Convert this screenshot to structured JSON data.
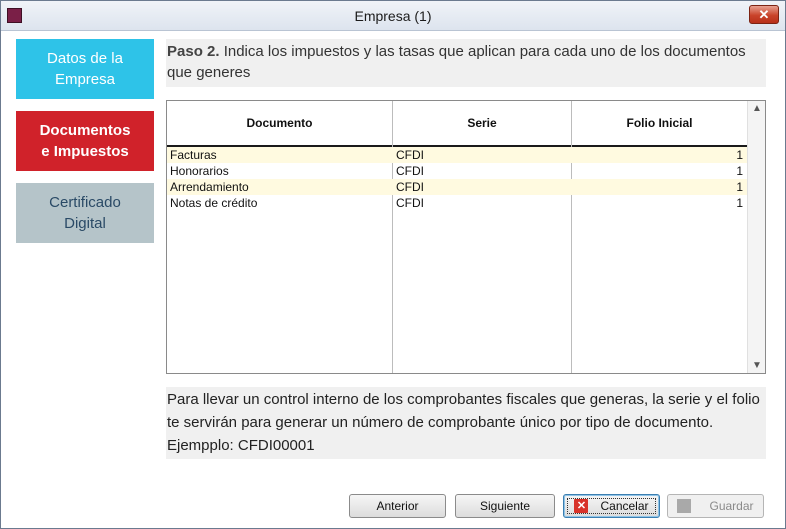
{
  "window": {
    "title": "Empresa (1)",
    "close_symbol": "✕"
  },
  "nav": {
    "items": [
      {
        "line1": "Datos de la",
        "line2": "Empresa"
      },
      {
        "line1": "Documentos",
        "line2": "e Impuestos"
      },
      {
        "line1": "Certificado",
        "line2": "Digital"
      }
    ]
  },
  "step": {
    "label": "Paso 2.",
    "text": "Indica los impuestos y las tasas que aplican para cada uno de los documentos que generes"
  },
  "table": {
    "headers": [
      "Documento",
      "Serie",
      "Folio Inicial"
    ],
    "rows": [
      {
        "documento": "Facturas",
        "serie": "CFDI",
        "folio": "1"
      },
      {
        "documento": "Honorarios",
        "serie": "CFDI",
        "folio": "1"
      },
      {
        "documento": "Arrendamiento",
        "serie": "CFDI",
        "folio": "1"
      },
      {
        "documento": "Notas de crédito",
        "serie": "CFDI",
        "folio": "1"
      }
    ]
  },
  "info": {
    "text": "Para llevar un control interno de los comprobantes fiscales que generas, la serie y el folio te servirán para generar un número de comprobante único por tipo de documento. Ejempplo: CFDI00001"
  },
  "buttons": {
    "anterior": "Anterior",
    "siguiente": "Siguiente",
    "cancelar": "Cancelar",
    "guardar": "Guardar",
    "cancel_icon_symbol": "✕"
  },
  "colors": {
    "nav_active": "#d0222a",
    "nav_datos": "#2ec3e8",
    "nav_certificado": "#b5c4c9",
    "row_alt": "#fffae0"
  }
}
